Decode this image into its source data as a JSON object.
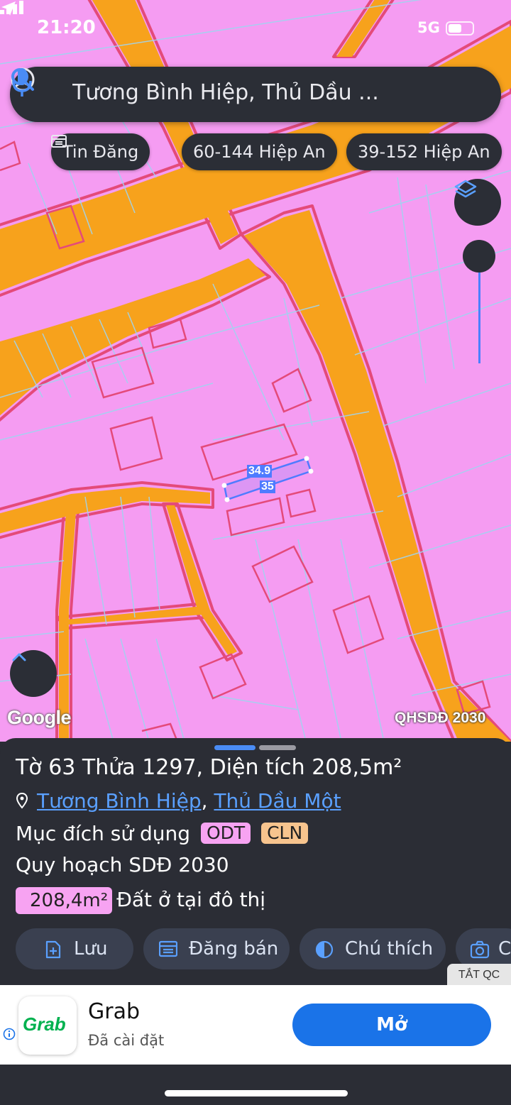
{
  "status_bar": {
    "time": "21:20",
    "network": "5G"
  },
  "search": {
    "query": "Tương Bình Hiệp, Thủ Dầu ..."
  },
  "chips": [
    {
      "label": "Tin Đăng",
      "icon": "listing-icon"
    },
    {
      "label": "60-144 Hiệp An"
    },
    {
      "label": "39-152 Hiệp An"
    }
  ],
  "map": {
    "provider_logo": "Google",
    "layer_label": "QHSDĐ 2030",
    "measurements": [
      "34.9",
      "35"
    ],
    "colors": {
      "residential": "#f59cf2",
      "road": "#f7a21c",
      "boundary": "#e44a7a"
    }
  },
  "parcel": {
    "title": "Tờ 63 Thửa 1297, Diện tích 208,5m²",
    "ward": "Tương Bình Hiệp",
    "separator": ",",
    "city": "Thủ Dầu Một",
    "purpose_label": "Mục đích sử dụng",
    "purpose_codes": [
      "ODT",
      "CLN"
    ],
    "plan_title": "Quy hoạch SDĐ 2030",
    "plan_area": "208,4m²",
    "plan_use": "Đất ở tại đô thị"
  },
  "actions": {
    "save": "Lưu",
    "post_sale": "Đăng bán",
    "legend": "Chú thích",
    "fourth": "C"
  },
  "ads_off_label": "TẮT QC",
  "ad": {
    "logo_text": "Grab",
    "app_name": "Grab",
    "status": "Đã cài đặt",
    "cta": "Mở",
    "accent": "#1a73e8"
  }
}
